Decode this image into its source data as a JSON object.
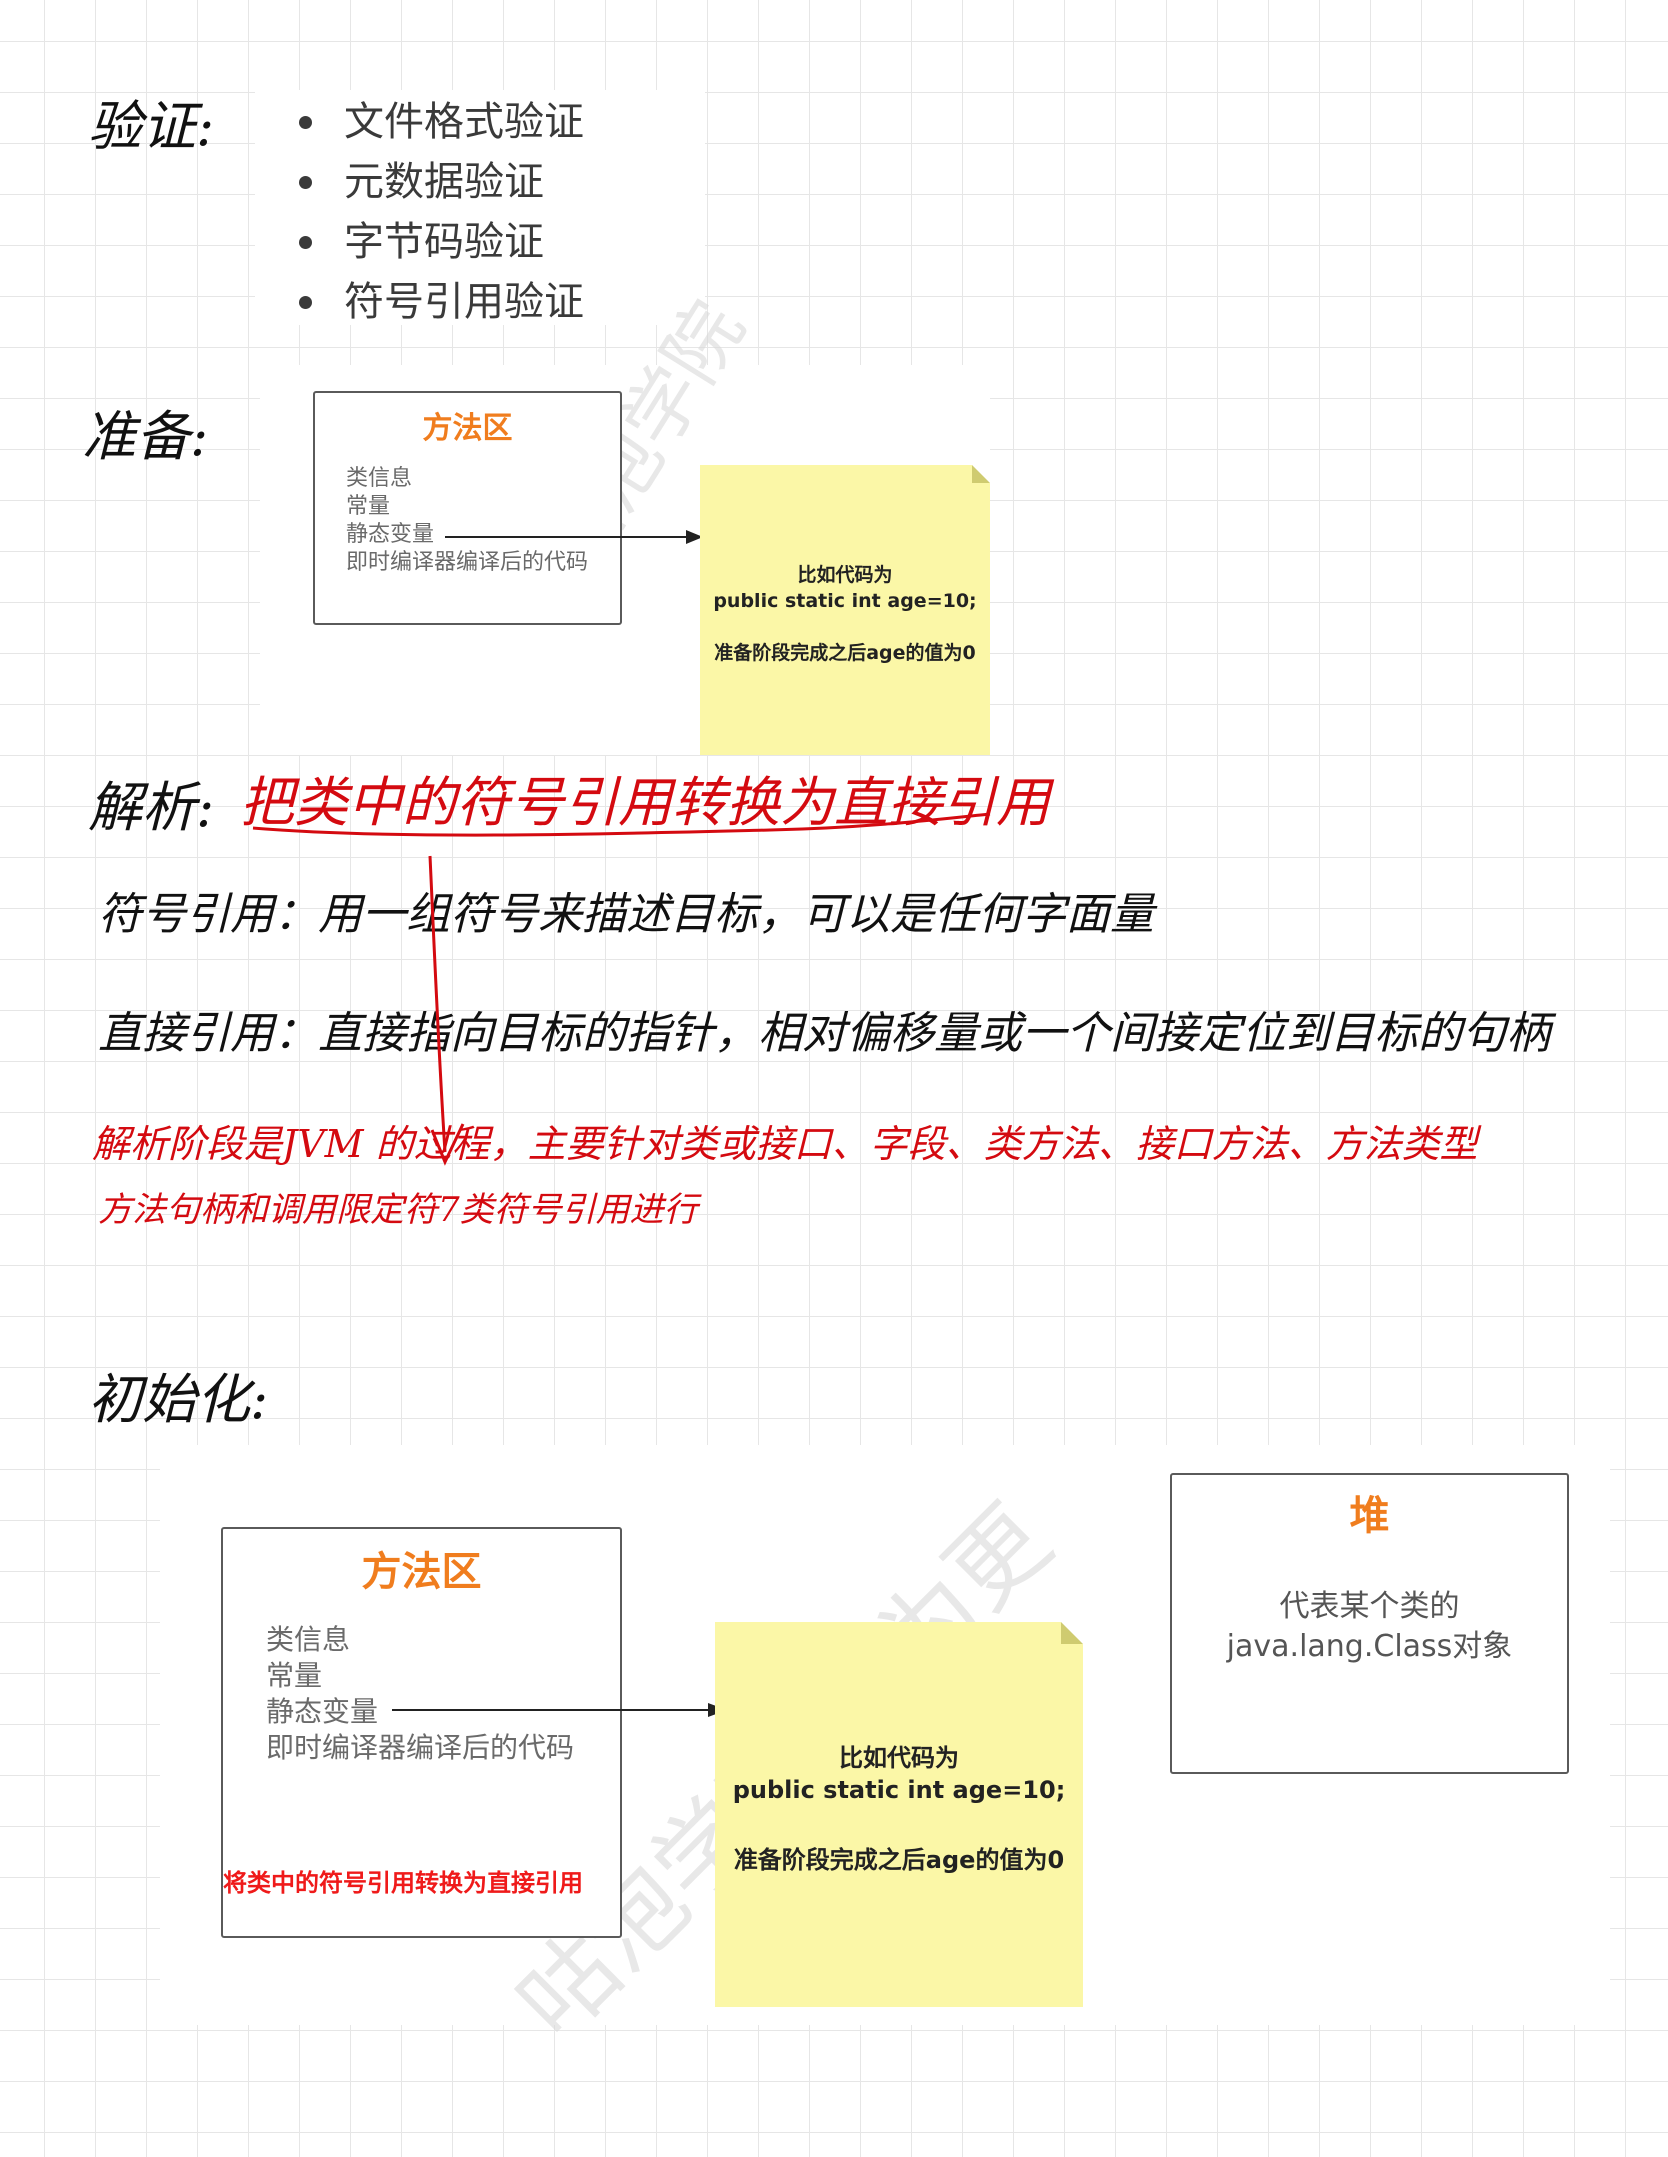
{
  "verify": {
    "label": "验证:",
    "items": [
      "文件格式验证",
      "元数据验证",
      "字节码验证",
      "符号引用验证"
    ]
  },
  "prepare": {
    "label": "准备:",
    "method_area": {
      "title": "方法区",
      "lines": [
        "类信息",
        "常量",
        "静态变量",
        "即时编译器编译后的代码"
      ]
    },
    "note": {
      "line1": "比如代码为",
      "line2": "public static int age=10;",
      "line3": "准备阶段完成之后age的值为0"
    },
    "watermark": "咕泡学院"
  },
  "resolve": {
    "label": "解析:",
    "red_definition": "把类中的符号引用转换为直接引用",
    "symbolic_ref": "符号引用：用一组符号来描述目标，可以是任何字面量",
    "direct_ref": "直接引用：直接指向目标的指针，相对偏移量或一个间接定位到目标的句柄",
    "red_note_line1": "解析阶段是JVM 的过程，主要针对类或接口、字段、类方法、接口方法、方法类型",
    "red_note_line2": "方法句柄和调用限定符7类符号引用进行"
  },
  "init": {
    "label": "初始化:",
    "method_area": {
      "title": "方法区",
      "lines": [
        "类信息",
        "常量",
        "静态变量",
        "即时编译器编译后的代码"
      ],
      "red_text": "将类中的符号引用转换为直接引用"
    },
    "note": {
      "line1": "比如代码为",
      "line2": "public static int age=10;",
      "line3": "准备阶段完成之后age的值为0"
    },
    "heap": {
      "title": "堆",
      "line1": "代表某个类的",
      "line2": "java.lang.Class对象"
    },
    "watermark": "咕泡学院 只为更"
  },
  "colors": {
    "accent_orange": "#f07d1e",
    "note_yellow": "#fbf7a7",
    "handwriting_red": "#d40a10",
    "grid": "#e6e6e6"
  }
}
